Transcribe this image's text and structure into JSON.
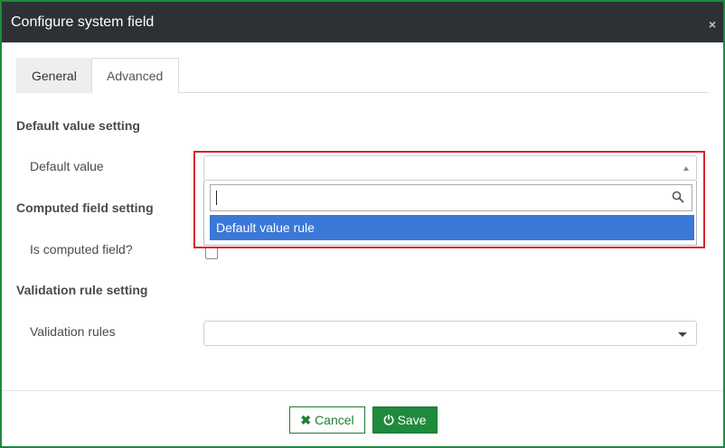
{
  "dialog": {
    "title": "Configure system field",
    "close_icon": "×"
  },
  "tabs": [
    {
      "label": "General"
    },
    {
      "label": "Advanced"
    }
  ],
  "sections": {
    "default_value": {
      "heading": "Default value setting",
      "field_label": "Default value",
      "search_value": "",
      "options": [
        "Default value rule"
      ]
    },
    "computed": {
      "heading": "Computed field setting",
      "field_label": "Is computed field?"
    },
    "validation": {
      "heading": "Validation rule setting",
      "field_label": "Validation rules"
    }
  },
  "footer": {
    "cancel_label": "Cancel",
    "cancel_icon": "✖",
    "save_label": "Save",
    "save_icon": "⏻"
  },
  "colors": {
    "accent_green": "#1e8a3c",
    "titlebar": "#2d3136",
    "highlight_red": "#d6232f",
    "option_selected": "#3c78d8"
  }
}
